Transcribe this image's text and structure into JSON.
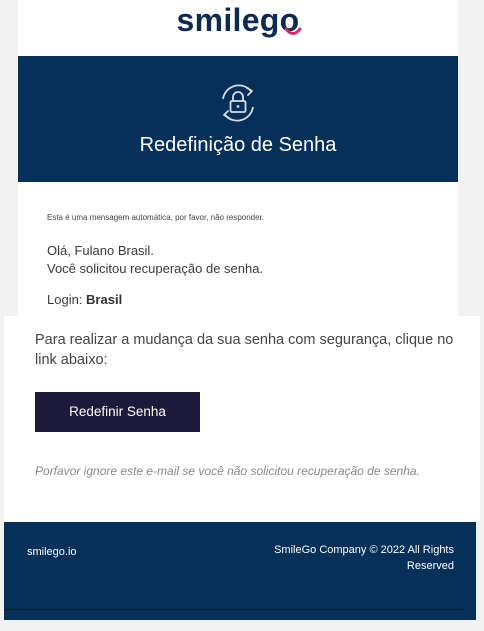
{
  "brand": {
    "logo_text": "smilego",
    "colors": {
      "navy": "#05305a",
      "accent": "#e0245e",
      "button": "#1d1a3c"
    }
  },
  "hero": {
    "icon": "lock-refresh-icon",
    "title": "Redefinição de Senha"
  },
  "body": {
    "auto_note": "Esta é uma mensagem automática, por favor, não responder.",
    "greeting": "Olá, Fulano Brasil.",
    "request_line": "Você solicitou recuperação de senha.",
    "login_label": "Login:",
    "login_value": "Brasil",
    "instructions": "Para realizar a mudança da sua senha com segurança, clique no link abaixo:",
    "button_label": "Redefinir Senha",
    "ignore_note": "Porfavor ignore este e-mail se você não solicitou recuperação de senha."
  },
  "footer": {
    "site": "smilego.io",
    "copyright": "SmileGo Company ©  2022 All Rights Reserved"
  }
}
